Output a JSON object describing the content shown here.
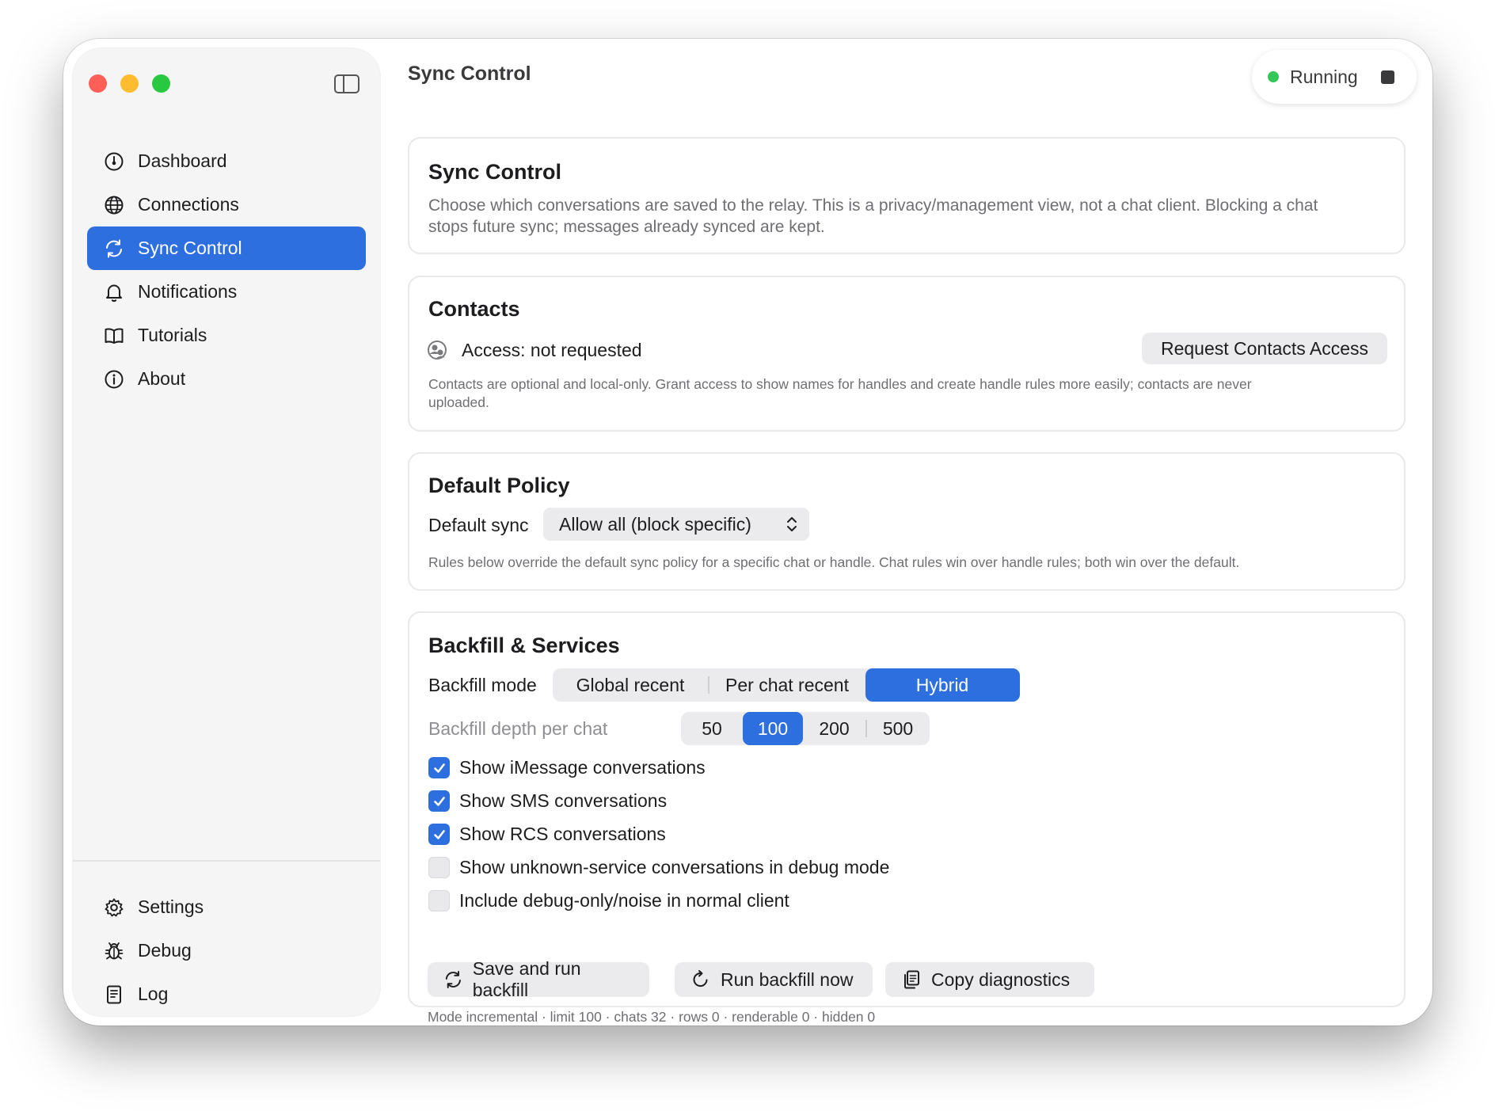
{
  "window": {
    "title": "Sync Control",
    "status": {
      "label": "Running",
      "color": "#34c759"
    }
  },
  "sidebar": {
    "items": [
      {
        "label": "Dashboard",
        "icon": "gauge-icon"
      },
      {
        "label": "Connections",
        "icon": "globe-icon"
      },
      {
        "label": "Sync Control",
        "icon": "sync-icon",
        "active": true
      },
      {
        "label": "Notifications",
        "icon": "bell-icon"
      },
      {
        "label": "Tutorials",
        "icon": "book-icon"
      },
      {
        "label": "About",
        "icon": "info-icon"
      }
    ],
    "bottom_items": [
      {
        "label": "Settings",
        "icon": "gear-icon"
      },
      {
        "label": "Debug",
        "icon": "bug-icon"
      },
      {
        "label": "Log",
        "icon": "document-icon"
      }
    ]
  },
  "intro": {
    "title": "Sync Control",
    "description": "Choose which conversations are saved to the relay. This is a privacy/management view, not a chat client. Blocking a chat stops future sync; messages already synced are kept."
  },
  "contacts": {
    "title": "Contacts",
    "access_label": "Access: not requested",
    "request_button": "Request Contacts Access",
    "note": "Contacts are optional and local-only. Grant access to show names for handles and create handle rules more easily; contacts are never uploaded."
  },
  "default_policy": {
    "title": "Default Policy",
    "sync_label": "Default sync",
    "sync_value": "Allow all (block specific)",
    "note": "Rules below override the default sync policy for a specific chat or handle. Chat rules win over handle rules; both win over the default."
  },
  "backfill": {
    "title": "Backfill & Services",
    "mode_label": "Backfill mode",
    "modes": [
      "Global recent",
      "Per chat recent",
      "Hybrid"
    ],
    "selected_mode": "Hybrid",
    "depth_label": "Backfill depth per chat",
    "depths": [
      "50",
      "100",
      "200",
      "500"
    ],
    "selected_depth": "100",
    "options": [
      {
        "label": "Show iMessage conversations",
        "checked": true
      },
      {
        "label": "Show SMS conversations",
        "checked": true
      },
      {
        "label": "Show RCS conversations",
        "checked": true
      },
      {
        "label": "Show unknown-service conversations in debug mode",
        "checked": false
      },
      {
        "label": "Include debug-only/noise in normal client",
        "checked": false
      }
    ],
    "actions": {
      "save_run": "Save and run backfill",
      "run_now": "Run backfill now",
      "copy_diag": "Copy diagnostics"
    },
    "status_line": "Mode incremental · limit 100 · chats 32 · rows 0 · renderable 0 · hidden 0"
  },
  "colors": {
    "accent": "#2e6fe0"
  }
}
